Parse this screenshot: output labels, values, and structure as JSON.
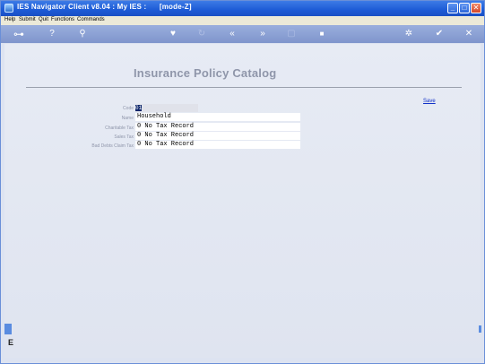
{
  "window": {
    "title": "IES Navigator Client v8.04 : My IES :      [mode-Z]",
    "minimize": "_",
    "maximize": "□",
    "close": "✕"
  },
  "menu": [
    "Help",
    "Submit",
    "Quit",
    "Functions",
    "Commands"
  ],
  "toolbar": {
    "key": "⊶",
    "help": "?",
    "search": "⚲",
    "heart": "♥",
    "refresh": "↻",
    "first": "«",
    "last": "»",
    "doc": "▢",
    "stop": "■",
    "settings": "✲",
    "check": "✔",
    "close": "✕"
  },
  "page": {
    "title": "Insurance Policy Catalog",
    "save_label": "Save"
  },
  "form": {
    "code": {
      "label": "Code",
      "value": "01"
    },
    "name": {
      "label": "Name",
      "value": "Household"
    },
    "charitable_tax": {
      "label": "Charitable Tax",
      "value": "0 No Tax Record"
    },
    "sales_tax": {
      "label": "Sales Tax",
      "value": "0 No Tax Record"
    },
    "bad_debts_claim_tax": {
      "label": "Bad Debts Claim Tax",
      "value": "0 No Tax Record"
    }
  },
  "sidebar": {
    "icon": "E"
  }
}
